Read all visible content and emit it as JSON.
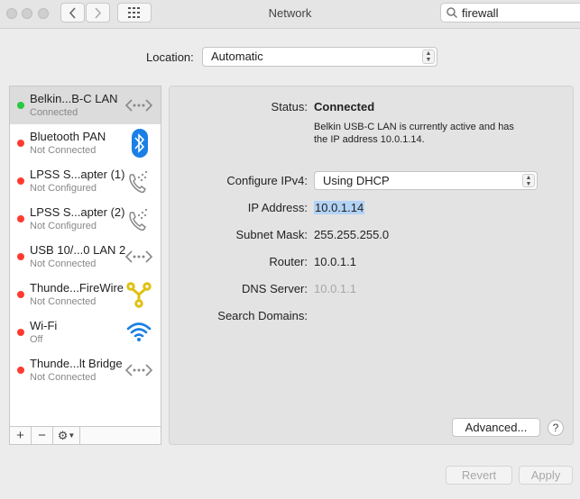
{
  "window": {
    "title": "Network"
  },
  "search": {
    "value": "firewall"
  },
  "location": {
    "label": "Location:",
    "value": "Automatic"
  },
  "services": [
    {
      "name": "Belkin...B-C LAN",
      "status": "Connected",
      "status_color": "#28c840",
      "icon": "ethernet-icon",
      "selected": true
    },
    {
      "name": "Bluetooth PAN",
      "status": "Not Connected",
      "status_color": "#ff3b30",
      "icon": "bluetooth-icon"
    },
    {
      "name": "LPSS S...apter (1)",
      "status": "Not Configured",
      "status_color": "#ff3b30",
      "icon": "phone-icon"
    },
    {
      "name": "LPSS S...apter (2)",
      "status": "Not Configured",
      "status_color": "#ff3b30",
      "icon": "phone-icon"
    },
    {
      "name": "USB 10/...0 LAN 2",
      "status": "Not Connected",
      "status_color": "#ff3b30",
      "icon": "ethernet-icon"
    },
    {
      "name": "Thunde...FireWire",
      "status": "Not Connected",
      "status_color": "#ff3b30",
      "icon": "firewire-icon"
    },
    {
      "name": "Wi-Fi",
      "status": "Off",
      "status_color": "#ff3b30",
      "icon": "wifi-icon"
    },
    {
      "name": "Thunde...lt Bridge",
      "status": "Not Connected",
      "status_color": "#ff3b30",
      "icon": "ethernet-icon"
    }
  ],
  "sidebar_tools": {
    "add": "+",
    "remove": "−"
  },
  "detail": {
    "status_label": "Status:",
    "status_value": "Connected",
    "status_desc_1": "Belkin USB-C LAN is currently active and has",
    "status_desc_2": "the IP address 10.0.1.14.",
    "configure_label": "Configure IPv4:",
    "configure_value": "Using DHCP",
    "ip_label": "IP Address:",
    "ip_value": "10.0.1.14",
    "subnet_label": "Subnet Mask:",
    "subnet_value": "255.255.255.0",
    "router_label": "Router:",
    "router_value": "10.0.1.1",
    "dns_label": "DNS Server:",
    "dns_value": "10.0.1.1",
    "search_domains_label": "Search Domains:"
  },
  "buttons": {
    "advanced": "Advanced...",
    "help": "?",
    "revert": "Revert",
    "apply": "Apply"
  }
}
